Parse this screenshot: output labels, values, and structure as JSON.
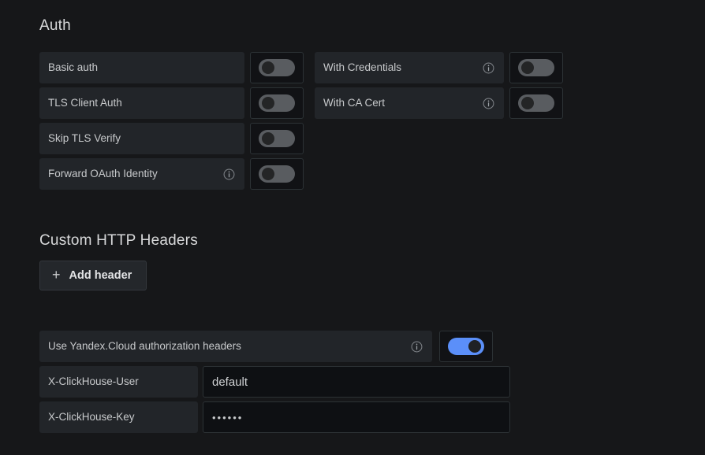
{
  "theme": {
    "background": "#161719",
    "label_bg": "#222529",
    "control_bg": "#111215",
    "border": "#2c3235",
    "text": "#d8d9da",
    "accent_on": "#5b8ff9",
    "input_bg": "#0e1013"
  },
  "auth": {
    "title": "Auth",
    "rows": [
      {
        "label": "Basic auth",
        "has_info": false,
        "toggle_on": false,
        "second": {
          "label": "With Credentials",
          "has_info": true,
          "toggle_on": false
        }
      },
      {
        "label": "TLS Client Auth",
        "has_info": false,
        "toggle_on": false,
        "second": {
          "label": "With CA Cert",
          "has_info": true,
          "toggle_on": false
        }
      },
      {
        "label": "Skip TLS Verify",
        "has_info": false,
        "toggle_on": false,
        "second": null
      },
      {
        "label": "Forward OAuth Identity",
        "has_info": true,
        "toggle_on": false,
        "second": null
      }
    ]
  },
  "custom_headers": {
    "title": "Custom HTTP Headers",
    "add_button": {
      "label": "Add header",
      "icon": "plus-icon"
    }
  },
  "yandex": {
    "toggle_row": {
      "label": "Use Yandex.Cloud authorization headers",
      "has_info": true,
      "toggle_on": true
    },
    "fields": [
      {
        "label": "X-ClickHouse-User",
        "value": "default",
        "placeholder": "",
        "secret": false
      },
      {
        "label": "X-ClickHouse-Key",
        "value": "••••••",
        "placeholder": "",
        "secret": true
      }
    ]
  },
  "icons": {
    "info": "info-circle-icon",
    "plus": "plus-icon"
  }
}
